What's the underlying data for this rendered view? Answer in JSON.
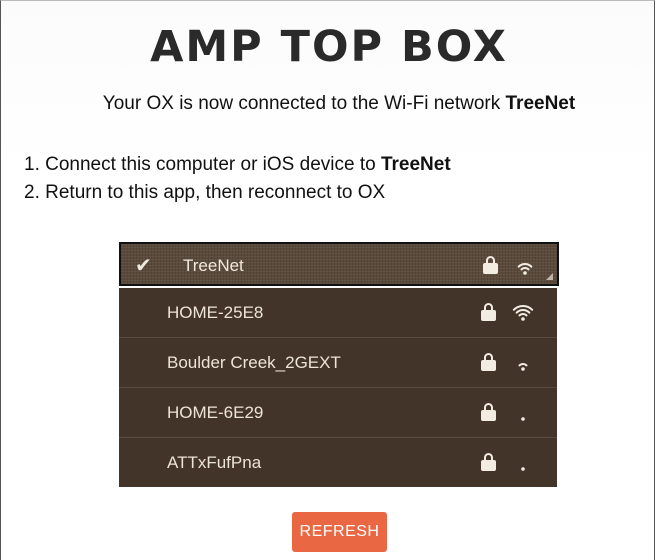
{
  "app": {
    "title": "AMP TOP BOX",
    "status_prefix": "Your OX is now connected to the Wi-Fi network ",
    "status_network": "TreeNet"
  },
  "steps": [
    {
      "prefix": "1. Connect this computer or iOS device to ",
      "bold": "TreeNet"
    },
    {
      "prefix": "2. Return to this app, then reconnect to OX",
      "bold": ""
    }
  ],
  "dropdown": {
    "selected": {
      "name": "TreeNet",
      "locked": true,
      "signal": 3
    },
    "networks": [
      {
        "name": "HOME-25E8",
        "locked": true,
        "signal": 4
      },
      {
        "name": "Boulder Creek_2GEXT",
        "locked": true,
        "signal": 2
      },
      {
        "name": "HOME-6E29",
        "locked": true,
        "signal": 1
      },
      {
        "name": "ATTxFufPna",
        "locked": true,
        "signal": 1
      }
    ]
  },
  "refresh_label": "REFRESH",
  "colors": {
    "dropdown_bg": "#43342a",
    "selected_bg": "#5a4a3b",
    "text_light": "#ece4d6",
    "accent": "#ea6743"
  },
  "icons": {
    "check": "check-icon",
    "lock": "lock-icon",
    "wifi": "wifi-icon"
  }
}
